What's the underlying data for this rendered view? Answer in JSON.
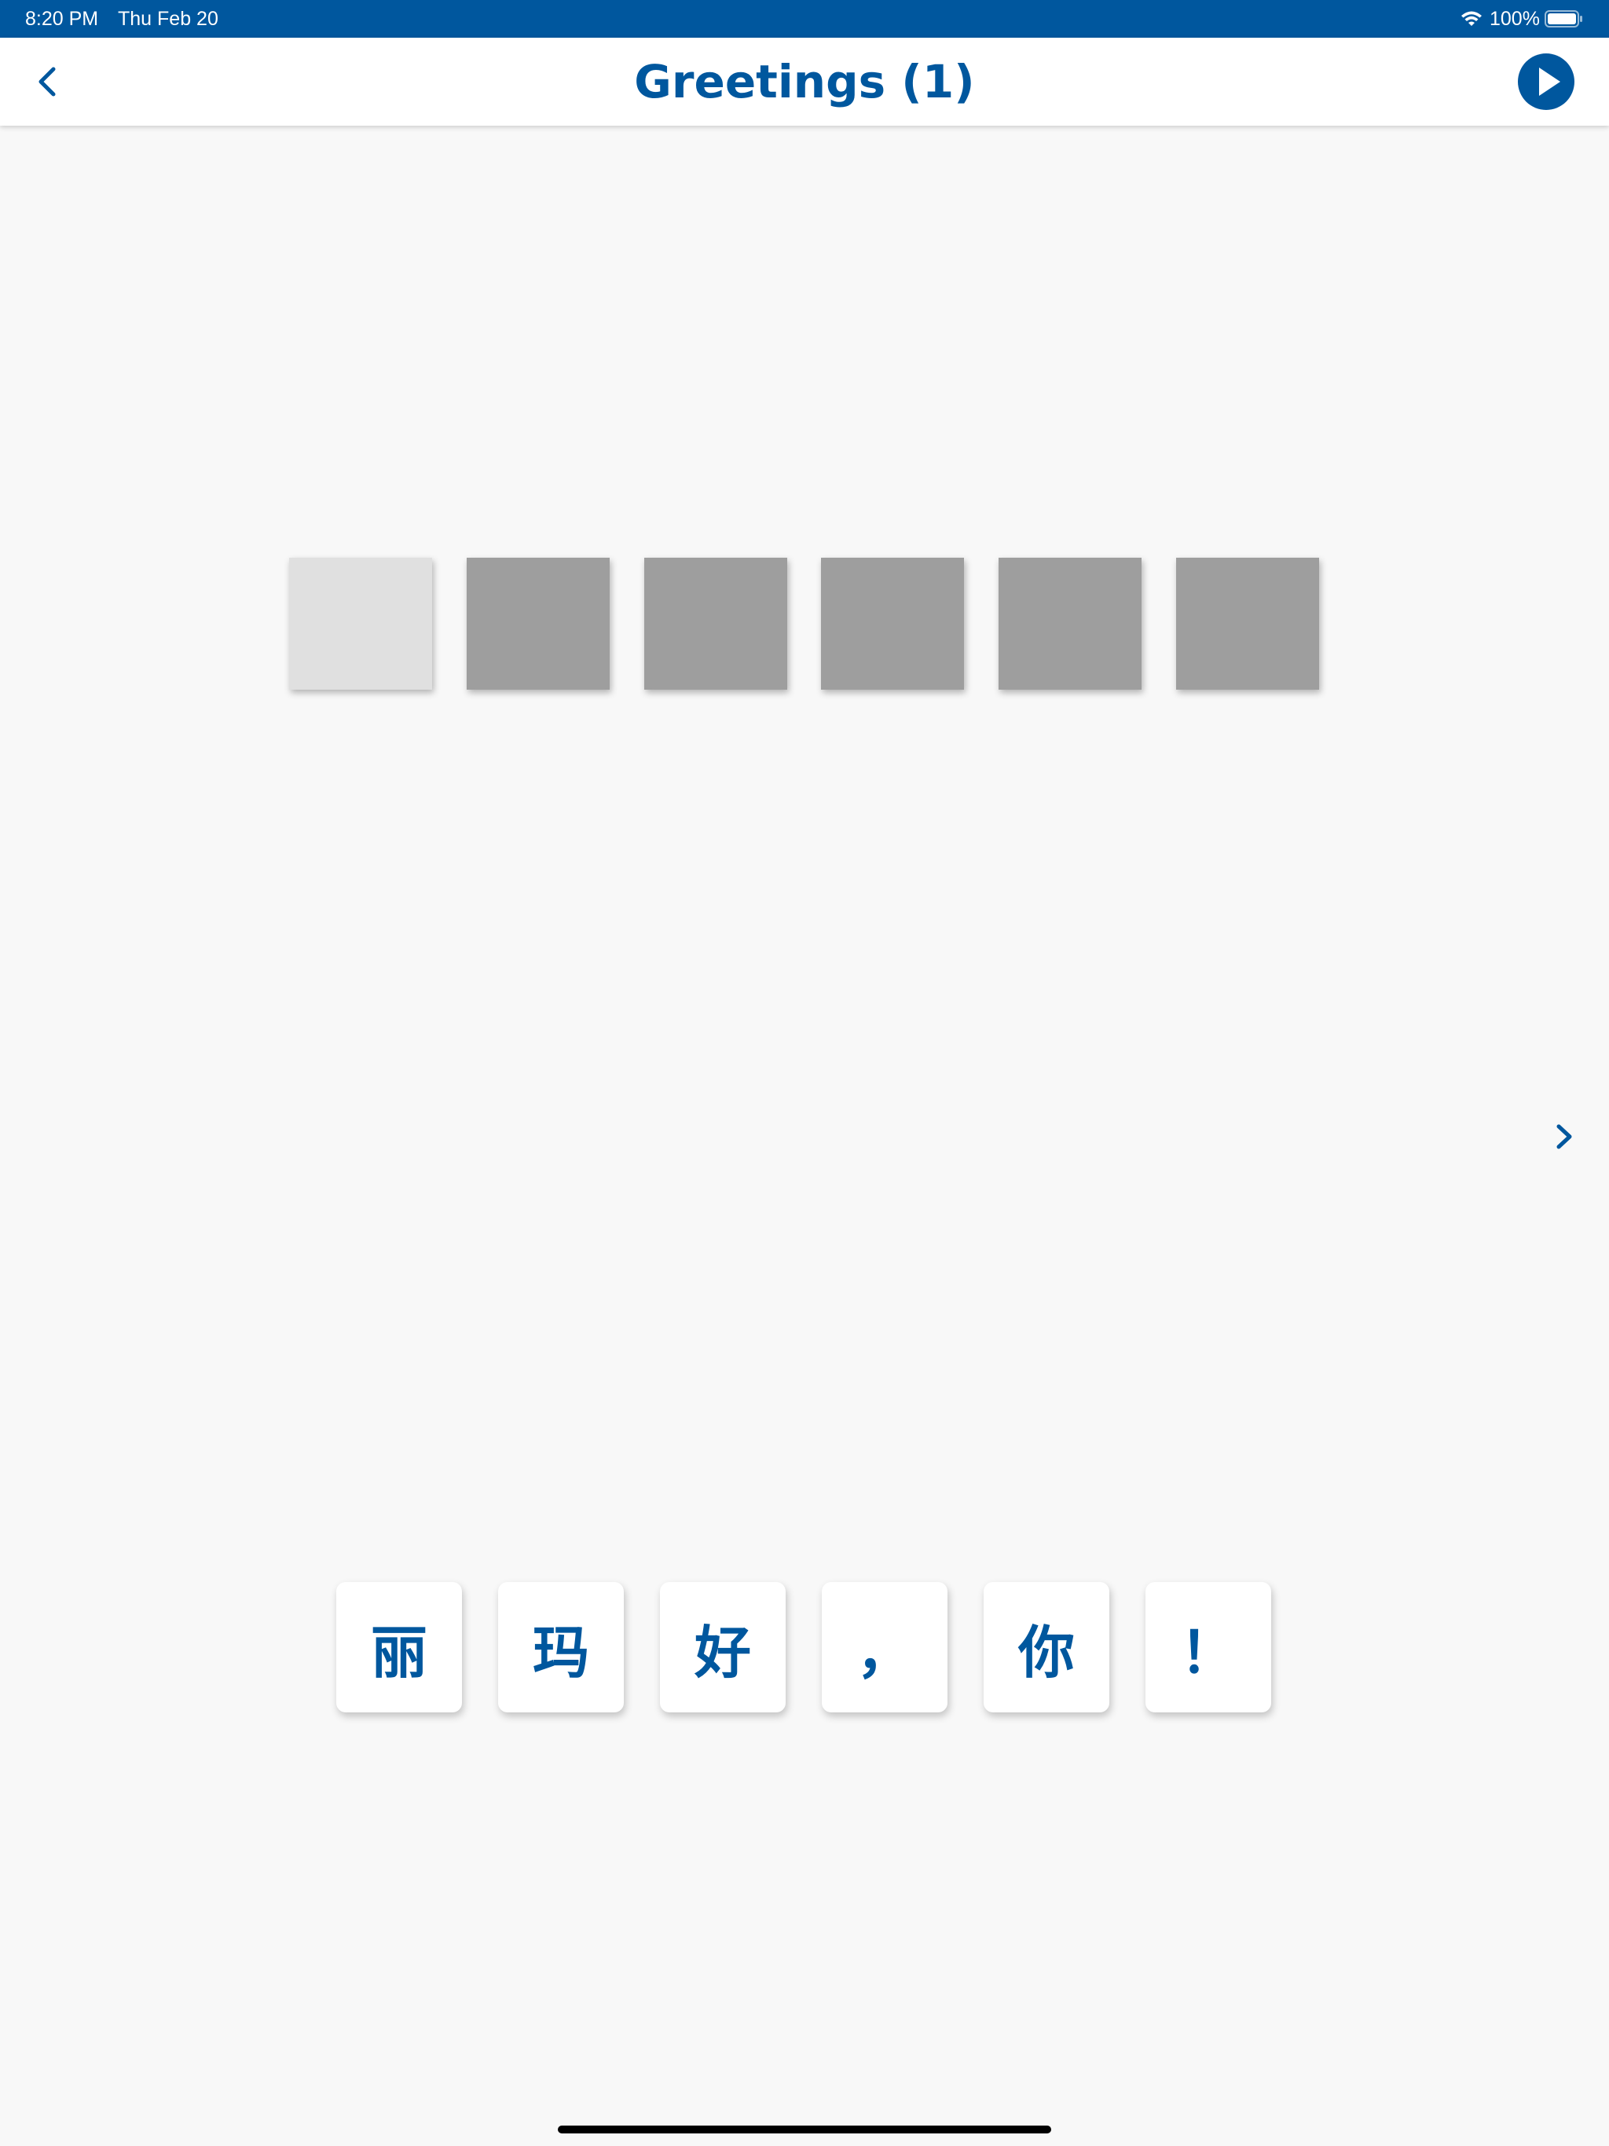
{
  "status_bar": {
    "time": "8:20 PM",
    "date": "Thu Feb 20",
    "battery": "100%",
    "wifi_icon": "wifi-icon",
    "battery_icon": "battery-icon"
  },
  "header": {
    "title": "Greetings (1)",
    "back_icon": "chevron-left-icon",
    "play_icon": "play-circle-icon"
  },
  "colors": {
    "accent": "#00579e",
    "background": "#f8f8f8",
    "slot_filled": "#9e9e9e",
    "slot_active": "#e0e0e0"
  },
  "answer_slots": [
    {
      "state": "active"
    },
    {
      "state": "empty"
    },
    {
      "state": "empty"
    },
    {
      "state": "empty"
    },
    {
      "state": "empty"
    },
    {
      "state": "empty"
    }
  ],
  "next_icon": "chevron-right-icon",
  "tiles": [
    {
      "char": "丽"
    },
    {
      "char": "玛"
    },
    {
      "char": "好"
    },
    {
      "char": "，"
    },
    {
      "char": "你"
    },
    {
      "char": "！"
    }
  ]
}
